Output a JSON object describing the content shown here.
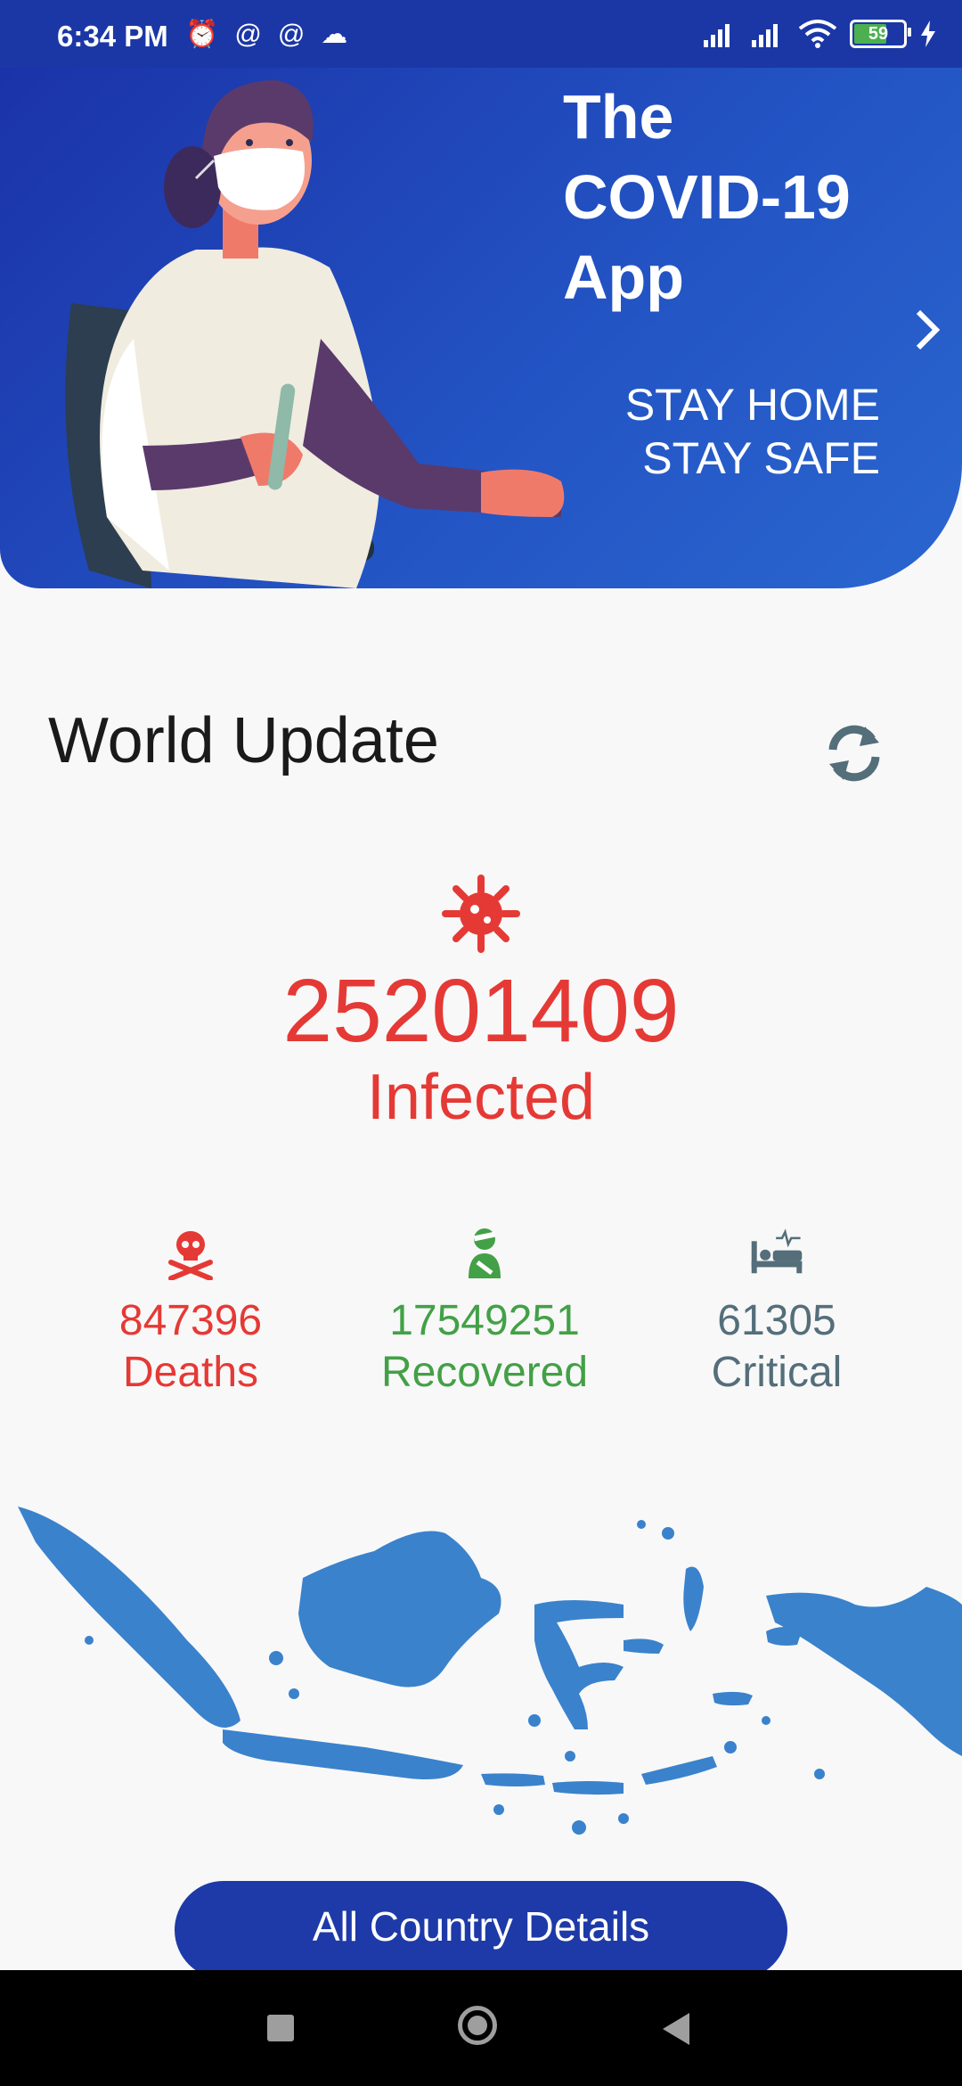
{
  "status_bar": {
    "time": "6:34 PM",
    "battery_level": "59",
    "icons": [
      "alarm-icon",
      "at-sign-icon",
      "at-sign-icon",
      "cloud-icon",
      "signal-icon",
      "signal-icon",
      "wifi-icon",
      "battery-icon",
      "charging-icon"
    ]
  },
  "banner": {
    "title": "The COVID-19 App",
    "subtitle_line1": "STAY HOME",
    "subtitle_line2": "STAY SAFE"
  },
  "world_update": {
    "title": "World Update",
    "infected": {
      "value": "25201409",
      "label": "Infected",
      "color": "#e53935"
    },
    "stats": [
      {
        "value": "847396",
        "label": "Deaths",
        "color": "#e53935",
        "icon": "skull-crossbones-icon"
      },
      {
        "value": "17549251",
        "label": "Recovered",
        "color": "#43a047",
        "icon": "injured-person-icon"
      },
      {
        "value": "61305",
        "label": "Critical",
        "color": "#546e7a",
        "icon": "hospital-bed-icon"
      }
    ]
  },
  "actions": {
    "all_country_button": "All Country Details"
  },
  "colors": {
    "brand_blue": "#1d3aa8",
    "map_blue": "#3a82cc",
    "background": "#f8f8f8"
  }
}
